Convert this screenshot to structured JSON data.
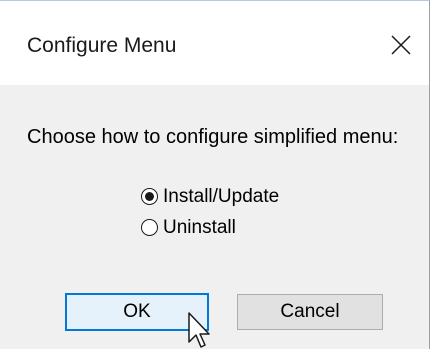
{
  "window": {
    "title": "Configure Menu",
    "close_icon": "close-icon"
  },
  "prompt": "Choose how to configure simplified menu:",
  "options": [
    {
      "label": "Install/Update",
      "selected": true
    },
    {
      "label": "Uninstall",
      "selected": false
    }
  ],
  "buttons": {
    "ok": "OK",
    "cancel": "Cancel"
  },
  "colors": {
    "accent": "#0078d7",
    "dialog_bg": "#f0f0f0",
    "title_bg": "#ffffff"
  },
  "cursor_icon": "mouse-pointer-icon"
}
